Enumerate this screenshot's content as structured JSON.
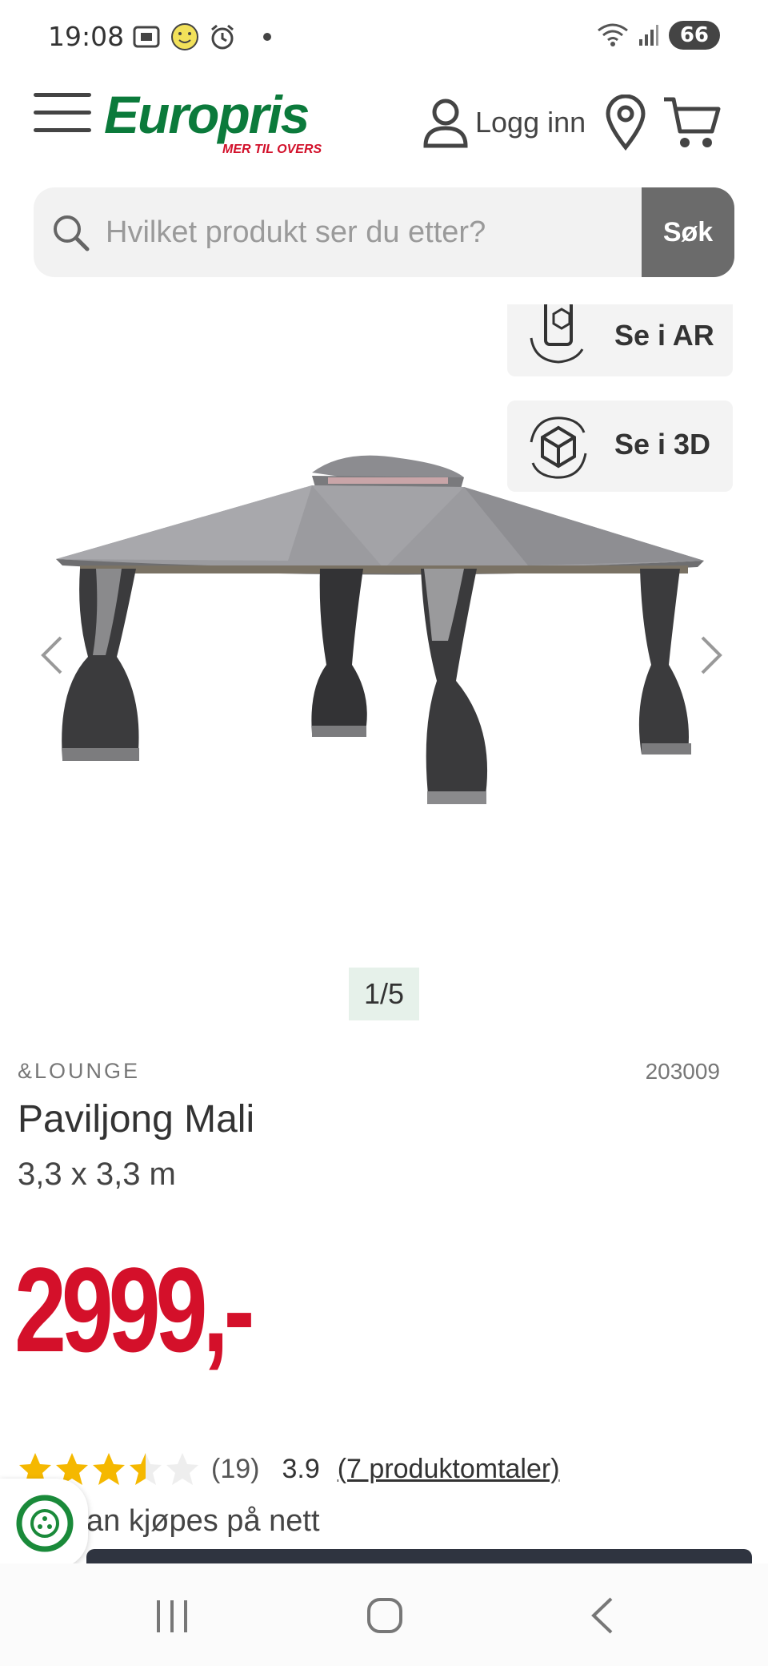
{
  "status_bar": {
    "time": "19:08",
    "battery": "66",
    "icons": [
      "screenshot-icon",
      "smiley-icon",
      "alarm-icon",
      "dot-icon",
      "wifi-icon",
      "signal-icon"
    ]
  },
  "header": {
    "logo": "Europris",
    "logo_tagline": "MER TIL OVERS",
    "login_label": "Logg inn",
    "icons": [
      "menu-icon",
      "user-icon",
      "location-pin-icon",
      "cart-icon"
    ]
  },
  "search": {
    "placeholder": "Hvilket produkt ser du etter?",
    "button_label": "Søk"
  },
  "gallery": {
    "ar_label": "Se i AR",
    "threed_label": "Se i 3D",
    "counter": "1/5"
  },
  "product": {
    "brand": "&LOUNGE",
    "sku": "203009",
    "title": "Paviljong Mali",
    "size": "3,3 x 3,3 m",
    "price": "2999,-"
  },
  "rating": {
    "stars": 3.5,
    "count": "(19)",
    "score": "3.9",
    "reviews_link": "(7 produktomtaler)"
  },
  "availability": {
    "text": "an kjøpes på nett"
  },
  "colors": {
    "brand_green": "#0b7a3b",
    "price_red": "#d4102a",
    "star_yellow": "#f5b800"
  }
}
